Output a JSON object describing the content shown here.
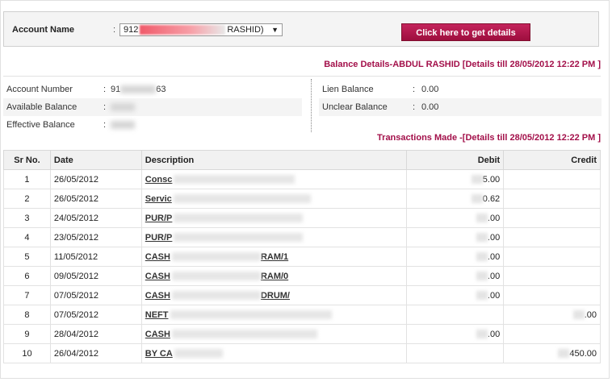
{
  "account_bar": {
    "label": "Account Name",
    "colon": ":",
    "select_prefix": "912",
    "select_suffix": "RASHID)",
    "select_arrow": "▼",
    "button_label": "Click here to get details"
  },
  "balance_section": {
    "title": "Balance Details-ABDUL RASHID [Details till 28/05/2012 12:22 PM ]",
    "left": [
      {
        "label": "Account Number",
        "value_prefix": "91",
        "value_suffix": "63"
      },
      {
        "label": "Available Balance",
        "value_prefix": "",
        "value_suffix": ""
      },
      {
        "label": "Effective Balance",
        "value_prefix": "",
        "value_suffix": ""
      }
    ],
    "right": [
      {
        "label": "Lien Balance",
        "value": "0.00"
      },
      {
        "label": "Unclear Balance",
        "value": "0.00"
      }
    ]
  },
  "transactions": {
    "title": "Transactions Made -[Details till 28/05/2012 12:22 PM ]",
    "headers": {
      "sr": "Sr No.",
      "date": "Date",
      "desc": "Description",
      "debit": "Debit",
      "credit": "Credit"
    },
    "rows": [
      {
        "sr": "1",
        "date": "26/05/2012",
        "desc_start": "Consc",
        "desc_end": "",
        "debit": "5.00",
        "credit": ""
      },
      {
        "sr": "2",
        "date": "26/05/2012",
        "desc_start": "Servic",
        "desc_end": "",
        "debit": "0.62",
        "credit": ""
      },
      {
        "sr": "3",
        "date": "24/05/2012",
        "desc_start": "PUR/P",
        "desc_end": "",
        "debit": ".00",
        "credit": ""
      },
      {
        "sr": "4",
        "date": "23/05/2012",
        "desc_start": "PUR/P",
        "desc_end": "",
        "debit": ".00",
        "credit": ""
      },
      {
        "sr": "5",
        "date": "11/05/2012",
        "desc_start": "CASH",
        "desc_end": "RAM/1",
        "debit": ".00",
        "credit": ""
      },
      {
        "sr": "6",
        "date": "09/05/2012",
        "desc_start": "CASH",
        "desc_end": "RAM/0",
        "debit": ".00",
        "credit": ""
      },
      {
        "sr": "7",
        "date": "07/05/2012",
        "desc_start": "CASH",
        "desc_end": "DRUM/",
        "debit": ".00",
        "credit": ""
      },
      {
        "sr": "8",
        "date": "07/05/2012",
        "desc_start": "NEFT",
        "desc_end": "",
        "debit": "",
        "credit": ".00"
      },
      {
        "sr": "9",
        "date": "28/04/2012",
        "desc_start": "CASH",
        "desc_end": "",
        "debit": ".00",
        "credit": ""
      },
      {
        "sr": "10",
        "date": "26/04/2012",
        "desc_start": "BY CA",
        "desc_end": "",
        "debit": "",
        "credit": "450.00"
      }
    ]
  }
}
